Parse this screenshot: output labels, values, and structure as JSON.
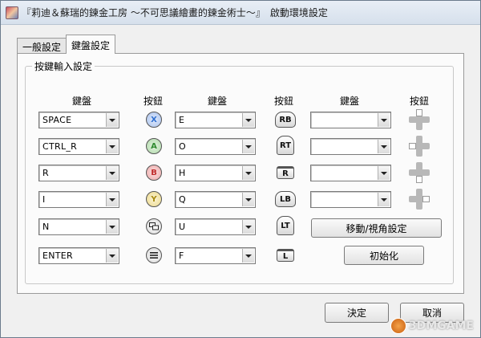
{
  "window": {
    "title": "『莉迪＆蘇瑞的鍊金工房 ～不可思議繪畫的鍊金術士～』　啟動環境設定"
  },
  "tabs": [
    {
      "label": "一般設定",
      "active": false
    },
    {
      "label": "鍵盤設定",
      "active": true
    }
  ],
  "group": {
    "title": "按鍵輸入設定",
    "headers": [
      "鍵盤",
      "按鈕",
      "鍵盤",
      "按鈕",
      "鍵盤",
      "按鈕"
    ]
  },
  "rows": [
    {
      "key1": "SPACE",
      "btn1": {
        "icon": "x-button-icon",
        "text": "X"
      },
      "key2": "E",
      "btn2": {
        "icon": "rb-bumper-icon",
        "text": "RB"
      },
      "key3": "",
      "btn3": "dpad-up-icon"
    },
    {
      "key1": "CTRL_R",
      "btn1": {
        "icon": "a-button-icon",
        "text": "A"
      },
      "key2": "O",
      "btn2": {
        "icon": "rt-trigger-icon",
        "text": "RT"
      },
      "key3": "",
      "btn3": "dpad-left-icon"
    },
    {
      "key1": "R",
      "btn1": {
        "icon": "b-button-icon",
        "text": "B"
      },
      "key2": "H",
      "btn2": {
        "icon": "right-stick-click-icon",
        "text": "R"
      },
      "key3": "",
      "btn3": "dpad-down-icon"
    },
    {
      "key1": "I",
      "btn1": {
        "icon": "y-button-icon",
        "text": "Y"
      },
      "key2": "Q",
      "btn2": {
        "icon": "lb-bumper-icon",
        "text": "LB"
      },
      "key3": "",
      "btn3": "dpad-right-icon"
    },
    {
      "key1": "N",
      "btn1": {
        "icon": "view-button-icon",
        "text": ""
      },
      "key2": "U",
      "btn2": {
        "icon": "lt-trigger-icon",
        "text": "LT"
      }
    },
    {
      "key1": "ENTER",
      "btn1": {
        "icon": "menu-button-icon",
        "text": ""
      },
      "key2": "F",
      "btn2": {
        "icon": "left-stick-click-icon",
        "text": "L"
      }
    }
  ],
  "buttons": {
    "move_view": "移動/視角設定",
    "reset": "初始化",
    "ok": "決定",
    "cancel": "取消"
  },
  "watermark": {
    "text": "3DMGAME"
  },
  "colors": {
    "x": "#2f6fd0",
    "a": "#3aa63a",
    "b": "#d33a3a",
    "y": "#e0b820"
  }
}
